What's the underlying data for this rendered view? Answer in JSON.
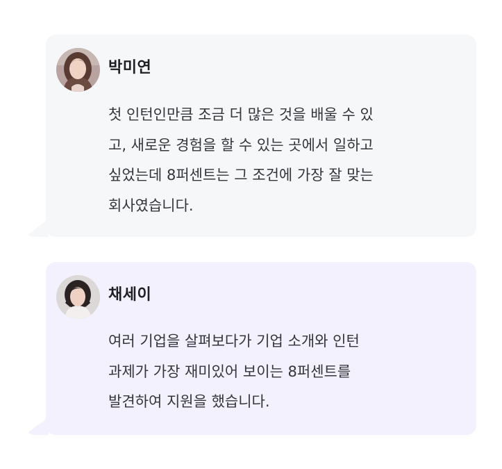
{
  "testimonials": [
    {
      "name": "박미연",
      "avatar_icon": "profile-photo-woman-long-hair",
      "background": "#f6f7f9",
      "quote": "첫 인턴인만큼 조금 더 많은 것을 배울 수 있고, 새로운 경험을 할 수 있는 곳에서 일하고 싶었는데 8퍼센트는 그 조건에 가장 잘 맞는 회사였습니다."
    },
    {
      "name": "채세이",
      "avatar_icon": "profile-photo-woman-short-hair",
      "background": "#f2f1fd",
      "quote": "여러 기업을 살펴보다가 기업 소개와 인턴 과제가 가장 재미있어 보이는 8퍼센트를 발견하여 지원을 했습니다."
    }
  ]
}
